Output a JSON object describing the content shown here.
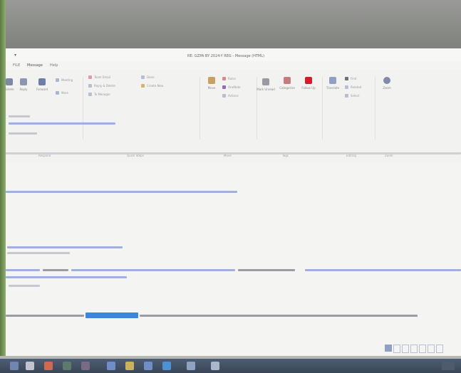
{
  "window": {
    "title": "RE: GZPA BY 2024-Y REG  -  Message (HTML)",
    "quick_access": "▾"
  },
  "ribbon": {
    "tab_active": "Message",
    "tab_file": "FILE",
    "tab_help": "Help",
    "buttons": [
      {
        "label": "Delete",
        "icon": "trash-icon"
      },
      {
        "label": "Reply",
        "icon": "reply-icon"
      },
      {
        "label": "Forward",
        "icon": "forward-icon"
      },
      {
        "label": "Move",
        "icon": "move-icon"
      },
      {
        "label": "Mark Unread",
        "icon": "envelope-icon"
      },
      {
        "label": "Categorize",
        "icon": "category-icon"
      },
      {
        "label": "Follow Up",
        "icon": "flag-icon"
      },
      {
        "label": "Translate",
        "icon": "translate-icon"
      },
      {
        "label": "Zoom",
        "icon": "zoom-icon"
      }
    ],
    "small_buttons": [
      {
        "label": "Meeting",
        "icon": "calendar-icon"
      },
      {
        "label": "More",
        "icon": "more-icon"
      },
      {
        "label": "Team Email",
        "icon": "team-icon"
      },
      {
        "label": "Reply & Delete",
        "icon": "reply-delete-icon"
      },
      {
        "label": "To Manager",
        "icon": "manager-icon"
      },
      {
        "label": "Done",
        "icon": "check-icon"
      },
      {
        "label": "Create New",
        "icon": "lightning-icon"
      },
      {
        "label": "Rules",
        "icon": "rules-icon"
      },
      {
        "label": "OneNote",
        "icon": "onenote-icon"
      },
      {
        "label": "Actions",
        "icon": "actions-icon"
      },
      {
        "label": "Find",
        "icon": "find-icon"
      },
      {
        "label": "Related",
        "icon": "related-icon"
      },
      {
        "label": "Select",
        "icon": "select-icon"
      }
    ],
    "groups": [
      "Respond",
      "Quick Steps",
      "Move",
      "Tags",
      "Editing",
      "Zoom"
    ]
  },
  "colors": {
    "link": "#9db0df",
    "selection": "#3c86e0",
    "text": "#9b9ba3",
    "taskbar": "#3a4658",
    "flag": "#d21c2a"
  }
}
